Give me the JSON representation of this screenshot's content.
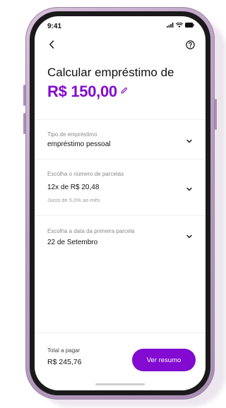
{
  "status_bar": {
    "time": "9:41"
  },
  "header": {
    "back_icon": "chevron-left-icon",
    "help_icon": "question-circle-icon"
  },
  "title": "Calcular empréstimo de",
  "amount": "R$ 150,00",
  "sections": [
    {
      "label": "Tipo de empréstimo",
      "value": "empréstimo pessoal"
    },
    {
      "label": "Escolha o número de parcelas",
      "value": "12x de R$ 20,48",
      "sub": "Juros de 5,0% ao mês"
    },
    {
      "label": "Escolha a data da primeira parcela",
      "value": "22 de Setembro"
    }
  ],
  "footer": {
    "total_label": "Total a pagar",
    "total_value": "R$ 245,76",
    "cta_label": "Ver resumo"
  },
  "colors": {
    "accent": "#820ad1",
    "phone_frame": "#bba0c3"
  }
}
